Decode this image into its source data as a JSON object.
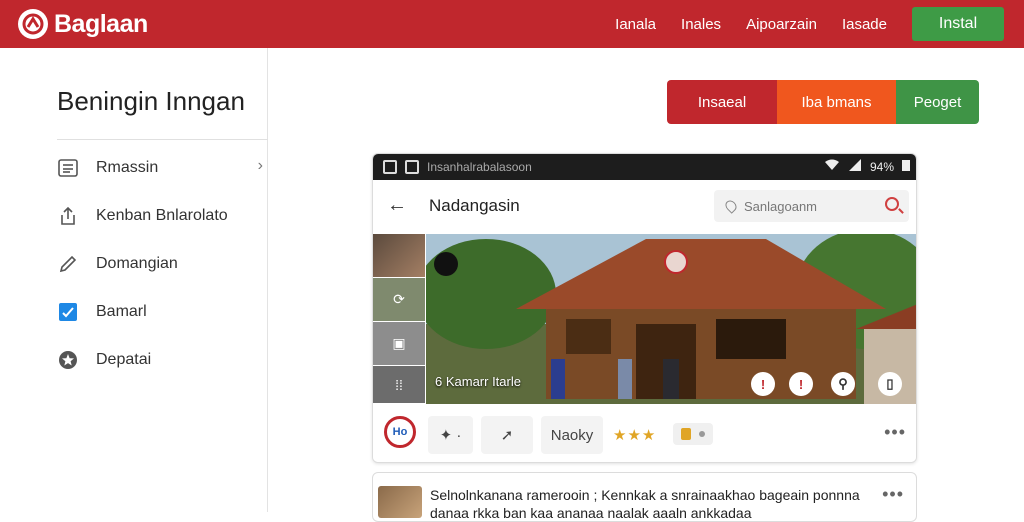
{
  "brand": {
    "name": "Baglaan"
  },
  "nav": {
    "items": [
      "Ianala",
      "Inales",
      "Aipoarzain",
      "Iasade"
    ],
    "install_label": "Instal"
  },
  "sidebar": {
    "title": "Beningin Inngan",
    "items": [
      {
        "label": "Rmassin",
        "icon": "list-icon",
        "has_chevron": true
      },
      {
        "label": "Kenban Bnlarolato",
        "icon": "share-icon"
      },
      {
        "label": "Domangian",
        "icon": "pencil-icon"
      },
      {
        "label": "Bamarl",
        "icon": "checkbox-icon"
      },
      {
        "label": "Depatai",
        "icon": "star-icon"
      }
    ]
  },
  "actions": {
    "install": "Insaeal",
    "browse": "Iba bmans",
    "pegget": "Peoget"
  },
  "phone": {
    "status_text": "Insanhalrabalasoon",
    "status_battery": "94%",
    "title": "Nadangasin",
    "search_placeholder": "Sanlagoanm",
    "image_caption": "6 Kamarr Itarle",
    "logo_text": "Ho",
    "action_label": "Naoky",
    "stars": "★★★"
  },
  "comment": {
    "text": "Selnolnkanana ramerooin ; Kennkak a snrainaakhao bageain ponnna danaa rkka ban kaa ananaa naalak aaaln ankkadaa"
  },
  "colors": {
    "brand_red": "#c0272d",
    "orange": "#f0571e",
    "green": "#3e9b46",
    "star_gold": "#e0a526"
  }
}
